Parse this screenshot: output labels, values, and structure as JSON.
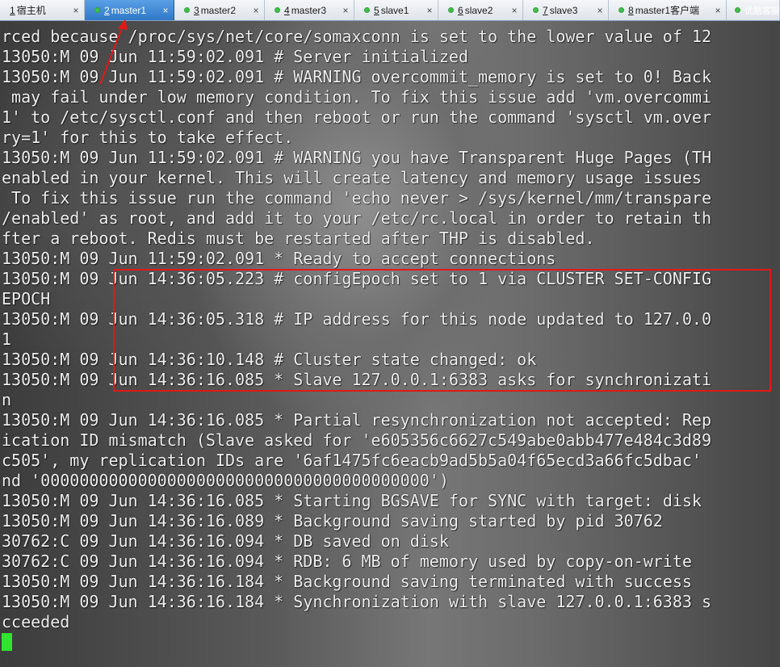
{
  "tabs": [
    {
      "num": "1",
      "label": "宿主机",
      "active": false,
      "status": "none"
    },
    {
      "num": "2",
      "label": "master1",
      "active": true,
      "status": "connected"
    },
    {
      "num": "3",
      "label": "master2",
      "active": false,
      "status": "connected"
    },
    {
      "num": "4",
      "label": "master3",
      "active": false,
      "status": "connected"
    },
    {
      "num": "5",
      "label": "slave1",
      "active": false,
      "status": "connected"
    },
    {
      "num": "6",
      "label": "slave2",
      "active": false,
      "status": "connected"
    },
    {
      "num": "7",
      "label": "slave3",
      "active": false,
      "status": "connected"
    },
    {
      "num": "8",
      "label": "master1客户端",
      "active": false,
      "status": "connected"
    }
  ],
  "watermark": "优酷客服",
  "terminal": {
    "lines": [
      "rced because /proc/sys/net/core/somaxconn is set to the lower value of 12",
      "13050:M 09 Jun 11:59:02.091 # Server initialized",
      "13050:M 09 Jun 11:59:02.091 # WARNING overcommit_memory is set to 0! Back",
      " may fail under low memory condition. To fix this issue add 'vm.overcommi",
      "1' to /etc/sysctl.conf and then reboot or run the command 'sysctl vm.over",
      "ry=1' for this to take effect.",
      "13050:M 09 Jun 11:59:02.091 # WARNING you have Transparent Huge Pages (TH",
      "enabled in your kernel. This will create latency and memory usage issues",
      " To fix this issue run the command 'echo never > /sys/kernel/mm/transpare",
      "/enabled' as root, and add it to your /etc/rc.local in order to retain th",
      "fter a reboot. Redis must be restarted after THP is disabled.",
      "13050:M 09 Jun 11:59:02.091 * Ready to accept connections",
      "13050:M 09 Jun 14:36:05.223 # configEpoch set to 1 via CLUSTER SET-CONFIG",
      "EPOCH",
      "13050:M 09 Jun 14:36:05.318 # IP address for this node updated to 127.0.0",
      "1",
      "13050:M 09 Jun 14:36:10.148 # Cluster state changed: ok",
      "13050:M 09 Jun 14:36:16.085 * Slave 127.0.0.1:6383 asks for synchronizati",
      "n",
      "13050:M 09 Jun 14:36:16.085 * Partial resynchronization not accepted: Rep",
      "ication ID mismatch (Slave asked for 'e605356c6627c549abe0abb477e484c3d89",
      "c505', my replication IDs are '6af1475fc6eacb9ad5b5a04f65ecd3a66fc5dbac'",
      "nd '0000000000000000000000000000000000000000')",
      "13050:M 09 Jun 14:36:16.085 * Starting BGSAVE for SYNC with target: disk",
      "13050:M 09 Jun 14:36:16.089 * Background saving started by pid 30762",
      "30762:C 09 Jun 14:36:16.094 * DB saved on disk",
      "30762:C 09 Jun 14:36:16.094 * RDB: 6 MB of memory used by copy-on-write",
      "13050:M 09 Jun 14:36:16.184 * Background saving terminated with success",
      "13050:M 09 Jun 14:36:16.184 * Synchronization with slave 127.0.0.1:6383 s",
      "cceeded"
    ]
  },
  "colors": {
    "text": "#f0f0f0",
    "cursor": "#2fe32f",
    "annotation": "#e01818",
    "tab_active": "#2f78c8",
    "status_dot": "#3fbf4a"
  }
}
